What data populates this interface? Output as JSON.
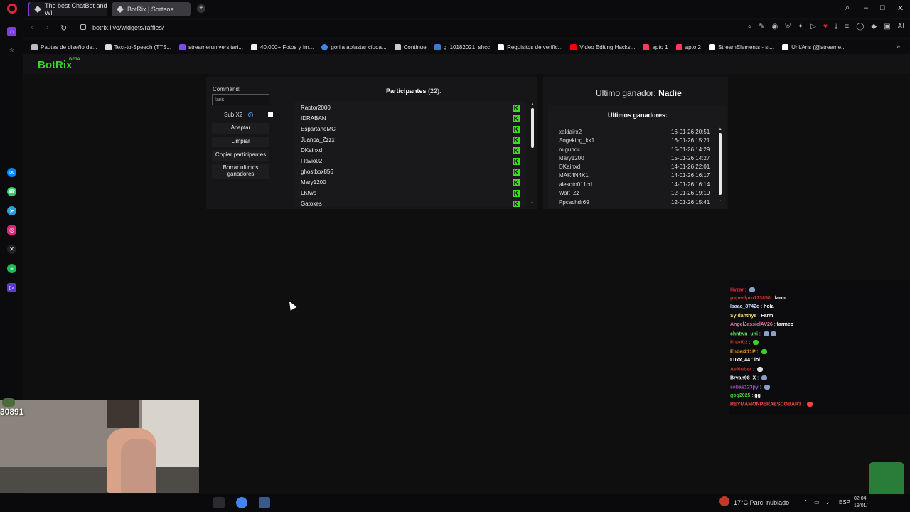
{
  "browser": {
    "tabs": [
      {
        "label": "The best ChatBot and Wi"
      },
      {
        "label": "BotRix | Sorteos"
      }
    ],
    "new_tab": "+",
    "url": "botrix.live/widgets/raffles/",
    "bookmarks": [
      {
        "label": "Pautas de diseño de...",
        "color": "#bbbbbb"
      },
      {
        "label": "Text-to-Speech (TTS...",
        "color": "#dddddd"
      },
      {
        "label": "streameruniversitari...",
        "color": "#7a4fe0"
      },
      {
        "label": "40.000+ Fotos y Im...",
        "color": "#eeeeee"
      },
      {
        "label": "gorila aplastar ciuda...",
        "color": "#4285f4"
      },
      {
        "label": "Continue",
        "color": "#cccccc"
      },
      {
        "label": "g_10182021_shcc",
        "color": "#3a7bd5"
      },
      {
        "label": "Requisitos de verific...",
        "color": "#ffffff"
      },
      {
        "label": "Video Editing Hacks...",
        "color": "#ff0000"
      },
      {
        "label": "apto 1",
        "color": "#ff385c"
      },
      {
        "label": "apto 2",
        "color": "#ff385c"
      },
      {
        "label": "StreamElements - st...",
        "color": "#ffffff"
      },
      {
        "label": "Uni/Aris (@streame...",
        "color": "#ffffff"
      }
    ],
    "bookmarks_more": "»"
  },
  "site": {
    "logo": "BotRix",
    "logo_badge": "BETA"
  },
  "raffle": {
    "command_label": "Command:",
    "command_value": "!aris",
    "sub_label": "Sub X2",
    "buttons": {
      "accept": "Aceptar",
      "clear": "Limpiar",
      "copy": "Copiar participantes",
      "delete": "Borrar ultimos ganadores"
    },
    "participants_title": "Participantes",
    "participants_count": "(22):",
    "participants": [
      "Raptor2000",
      "IDRABAN",
      "EspartanoMC",
      "Juanpa_Zzzx",
      "DKainxd",
      "Flavio02",
      "ghostbox856",
      "Mary1200",
      "LKtwo",
      "Gatoxes"
    ],
    "last_winner_label": "Ultimo ganador:",
    "last_winner_value": "Nadie",
    "last_winners_title": "Ultimos ganadores:",
    "last_winners": [
      {
        "name": "xaldairx2",
        "date": "16-01-26 20:51"
      },
      {
        "name": "Sogeking_kk1",
        "date": "16-01-26 15:21"
      },
      {
        "name": "migundc",
        "date": "15-01-26 14:29"
      },
      {
        "name": "Mary1200",
        "date": "15-01-26 14:27"
      },
      {
        "name": "DKainxd",
        "date": "14-01-26 22:01"
      },
      {
        "name": "MAK4N4K1",
        "date": "14-01-26 16:17"
      },
      {
        "name": "alesoto011cd",
        "date": "14-01-26 16:14"
      },
      {
        "name": "Walt_Zz",
        "date": "12-01-26 19:19"
      },
      {
        "name": "Ppcachdr69",
        "date": "12-01-26 15:41"
      }
    ]
  },
  "chat": [
    {
      "user": "Hyzar",
      "msg": "",
      "color": "#e0243a"
    },
    {
      "user": "papeelprn123850",
      "msg": "farm",
      "color": "#c0392b"
    },
    {
      "user": "Isaac_8742o",
      "msg": "hola",
      "color": "#cfd8ff"
    },
    {
      "user": "Syldanthys",
      "msg": "Farm",
      "color": "#f5d76e"
    },
    {
      "user": "AngelJassielAV26",
      "msg": "farmeo",
      "color": "#e07a9a"
    },
    {
      "user": "chntwn_uni",
      "msg": "",
      "color": "#5fe05f"
    },
    {
      "user": "Fravi02",
      "msg": "",
      "color": "#c0392b"
    },
    {
      "user": "Ender211P",
      "msg": "",
      "color": "#f39c12"
    },
    {
      "user": "Luxx_44",
      "msg": "lol",
      "color": "#ffffff"
    },
    {
      "user": "Ael6uber",
      "msg": "",
      "color": "#c0392b"
    },
    {
      "user": "Bryan98_X",
      "msg": "",
      "color": "#ffffff"
    },
    {
      "user": "sebas123py",
      "msg": "",
      "color": "#9b59b6"
    },
    {
      "user": "gog2025",
      "msg": "gg",
      "color": "#3ad12b"
    },
    {
      "user": "REYMAMONPERAESCOBAR3",
      "msg": "",
      "color": "#e74c3c"
    }
  ],
  "webcam": {
    "counter": "30891"
  },
  "taskbar": {
    "weather": "17°C  Parc. nublado",
    "lang": "ESP",
    "time": "02:04",
    "date": "19/01/"
  },
  "colors": {
    "accent": "#3ad12b",
    "kick": "#39e21f",
    "opera": "#e0243a"
  }
}
